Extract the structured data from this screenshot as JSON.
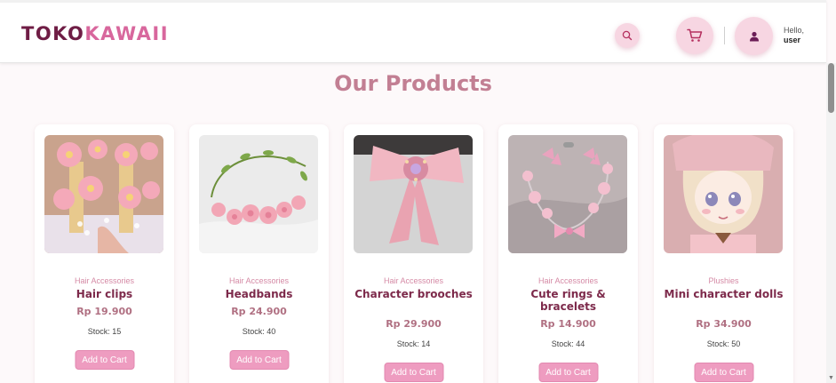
{
  "header": {
    "logo_part1": "TOKO",
    "logo_part2": "KAWAII",
    "search_icon": "search-icon",
    "cart_icon": "cart-icon",
    "user_icon": "user-icon",
    "greeting": "Hello,",
    "username": "user"
  },
  "colors": {
    "brand_dark": "#6f1d45",
    "brand_pink": "#d8679d",
    "button_pink": "#ee9cc0",
    "title_pink": "#c27f93"
  },
  "main": {
    "title": "Our Products",
    "products": [
      {
        "category": "Hair Accessories",
        "name": "Hair clips",
        "price": "Rp 19.900",
        "stock": "Stock: 15",
        "button": "Add to Cart"
      },
      {
        "category": "Hair Accessories",
        "name": "Headbands",
        "price": "Rp 24.900",
        "stock": "Stock: 40",
        "button": "Add to Cart"
      },
      {
        "category": "Hair Accessories",
        "name": "Character brooches",
        "price": "Rp 29.900",
        "stock": "Stock: 14",
        "button": "Add to Cart"
      },
      {
        "category": "Hair Accessories",
        "name": "Cute rings & bracelets",
        "price": "Rp 14.900",
        "stock": "Stock: 44",
        "button": "Add to Cart"
      },
      {
        "category": "Plushies",
        "name": "Mini character dolls",
        "price": "Rp 34.900",
        "stock": "Stock: 50",
        "button": "Add to Cart"
      }
    ]
  }
}
